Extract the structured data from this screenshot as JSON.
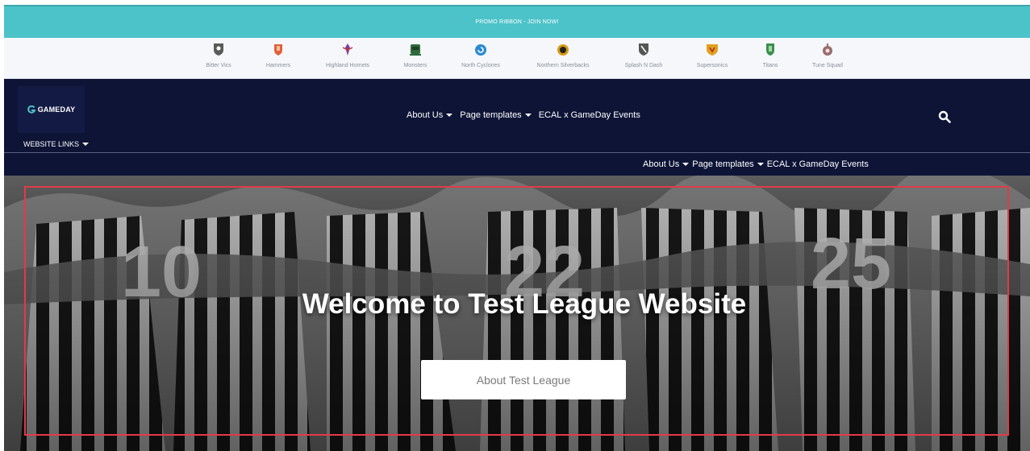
{
  "promo": {
    "text": "PROMO RIBBON - JOIN NOW!"
  },
  "clubs": [
    {
      "name": "Bitter Vics",
      "icon": "shield-icon",
      "color": "#5a5a5a"
    },
    {
      "name": "Hammers",
      "icon": "shield-icon",
      "color": "#e0603a"
    },
    {
      "name": "Highland Hornets",
      "icon": "fleur-icon",
      "color": "#7b3fa0"
    },
    {
      "name": "Monsters",
      "icon": "monster-icon",
      "color": "#2f6b3a"
    },
    {
      "name": "North Cyclones",
      "icon": "cyclone-icon",
      "color": "#2a8ad1"
    },
    {
      "name": "Northern Silverbacks",
      "icon": "badge-icon",
      "color": "#d89a12"
    },
    {
      "name": "Splash N Dash",
      "icon": "shield-icon",
      "color": "#555555"
    },
    {
      "name": "Supersonics",
      "icon": "shield-icon",
      "color": "#e0a020"
    },
    {
      "name": "Titans",
      "icon": "shield-icon",
      "color": "#3a8f4a"
    },
    {
      "name": "Tune Squad",
      "icon": "badge-icon",
      "color": "#9a6b6b"
    }
  ],
  "brand": {
    "name": "GAMEDAY",
    "accent": "#4cc3c9"
  },
  "website_links": {
    "label": "WEBSITE LINKS"
  },
  "nav": {
    "items": [
      {
        "label": "About Us",
        "dropdown": true
      },
      {
        "label": "Page templates",
        "dropdown": true
      },
      {
        "label": "ECAL x GameDay Events",
        "dropdown": false
      }
    ]
  },
  "hero": {
    "title": "Welcome to Test League Website",
    "button_label": "About Test League",
    "border_color": "#e23b46"
  }
}
